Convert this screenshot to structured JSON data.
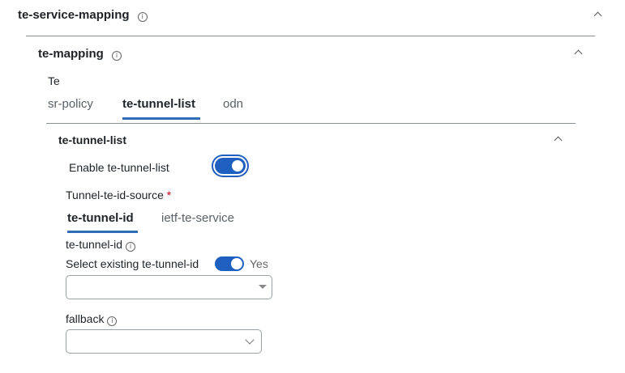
{
  "service_mapping": {
    "title": "te-service-mapping"
  },
  "te_mapping": {
    "title": "te-mapping",
    "group_label": "Te",
    "tabs": [
      "sr-policy",
      "te-tunnel-list",
      "odn"
    ],
    "active_tab": "te-tunnel-list"
  },
  "te_tunnel_list": {
    "title": "te-tunnel-list",
    "enable_label": "Enable te-tunnel-list",
    "enable_on": true,
    "source_label": "Tunnel-te-id-source",
    "required_mark": "*",
    "source_tabs": [
      "te-tunnel-id",
      "ietf-te-service"
    ],
    "active_source_tab": "te-tunnel-id",
    "tunnel_id_label": "te-tunnel-id",
    "select_existing_label": "Select existing te-tunnel-id",
    "select_existing_on": true,
    "select_existing_state": "Yes",
    "tunnel_id_value": "",
    "fallback_label": "fallback",
    "fallback_value": ""
  },
  "colors": {
    "accent": "#2f6db5",
    "toggle": "#1f5fbf",
    "required": "#d0021b"
  }
}
